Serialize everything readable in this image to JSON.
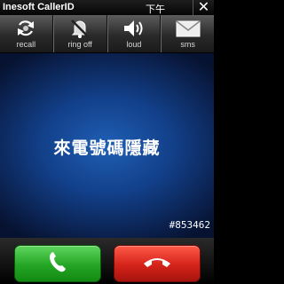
{
  "titlebar": {
    "title": "Inesoft CallerID",
    "time": "下午",
    "close_label": "✕"
  },
  "toolbar": {
    "items": [
      {
        "label": "recall",
        "icon": "recall-icon"
      },
      {
        "label": "ring off",
        "icon": "bell-off-icon"
      },
      {
        "label": "loud",
        "icon": "speaker-icon"
      },
      {
        "label": "sms",
        "icon": "envelope-icon"
      }
    ]
  },
  "main": {
    "message": "來電號碼隱藏",
    "watermark": "#853462"
  },
  "buttons": {
    "answer": {
      "icon": "phone-answer-icon",
      "color": "#24a524"
    },
    "reject": {
      "icon": "phone-hangup-icon",
      "color": "#d4231a"
    }
  }
}
